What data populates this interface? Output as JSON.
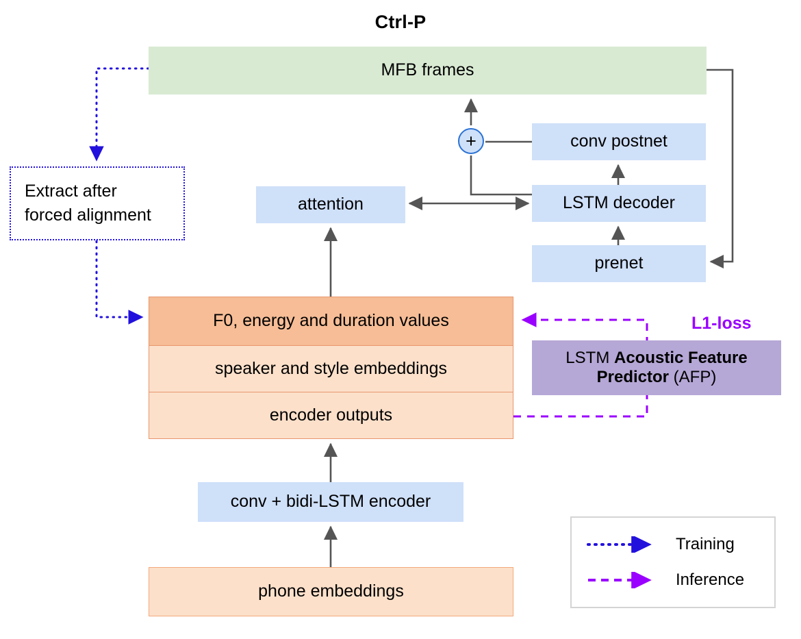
{
  "title": "Ctrl-P",
  "colors": {
    "mfb_green": "#d9ead3",
    "module_blue": "#cfe0f9",
    "highlight_orange": "#f6bd96",
    "light_orange": "#fce0ca",
    "afp_purple": "#b5a7d6",
    "loss_magenta": "#9a00ff",
    "training_blue": "#2211dd",
    "inference_purple": "#9a00ff",
    "arrow_gray": "#555555"
  },
  "nodes": {
    "mfb_frames": "MFB frames",
    "conv_postnet": "conv postnet",
    "lstm_decoder": "LSTM decoder",
    "prenet": "prenet",
    "attention": "attention",
    "encoder": "conv + bidi-LSTM encoder",
    "f0_values": "F0, energy and duration values",
    "speaker_style": "speaker and style embeddings",
    "encoder_outputs": "encoder outputs",
    "phone_embeddings": "phone embeddings",
    "extract_box": "Extract after\nforced alignment",
    "plus_node": "+",
    "l1_loss": "L1-loss",
    "afp": {
      "prefix": "LSTM ",
      "bold1": "Acoustic Feature",
      "bold2": "Predictor",
      "suffix": " (AFP)"
    }
  },
  "legend": {
    "training_label": "Training",
    "inference_label": "Inference"
  },
  "icons": {
    "plus": "plus-icon",
    "training_arrow": "dotted-arrow-icon",
    "inference_arrow": "dashed-arrow-icon"
  }
}
